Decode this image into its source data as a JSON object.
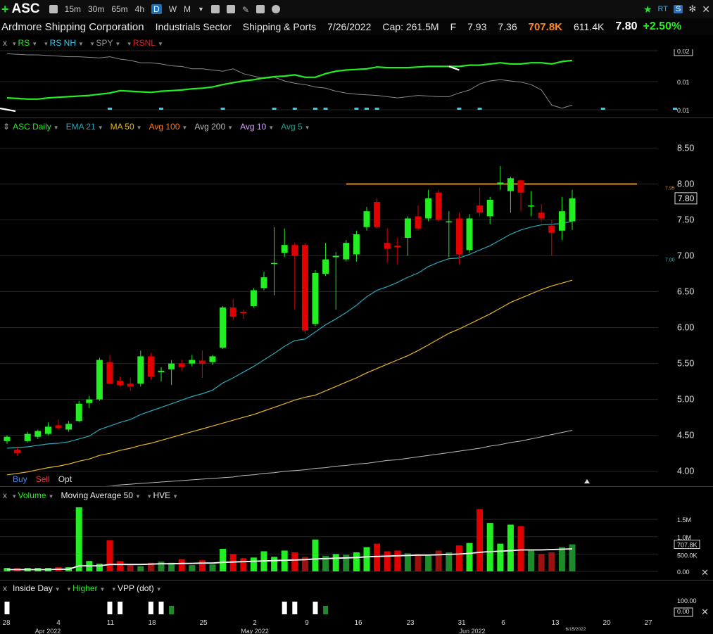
{
  "toolbar": {
    "symbol": "ASC",
    "timeframes": [
      "15m",
      "30m",
      "65m",
      "4h",
      "D",
      "W",
      "M"
    ],
    "active_timeframe": "D",
    "right_rt": "RT",
    "right_s": "S"
  },
  "info": {
    "company": "Ardmore Shipping Corporation",
    "sector": "Industrials Sector",
    "industry": "Shipping & Ports",
    "date": "7/26/2022",
    "cap": "Cap: 261.5M",
    "f": "F",
    "high": "7.93",
    "low": "7.36",
    "volume": "707.8K",
    "avg_volume": "611.4K",
    "last": "7.80",
    "change": "+2.50%"
  },
  "colors": {
    "up": "#22ee22",
    "down": "#e00000",
    "ema21": "#2aa7b8",
    "ma50": "#e8b820",
    "avg200": "#bbbbbb",
    "resistance": "#e08a18",
    "background": "#000000"
  },
  "rs_panel": {
    "legend": [
      {
        "label": "RS",
        "color": "#22ee22"
      },
      {
        "label": "RS NH",
        "color": "#33ccee"
      },
      {
        "label": "SPY",
        "color": "#999999"
      },
      {
        "label": "RSNL",
        "color": "#dd2222"
      }
    ],
    "axis_labels": [
      "0.02",
      "0.01",
      "0.01"
    ]
  },
  "price_legend": [
    {
      "label": "ASC Daily",
      "color": "#22ee22"
    },
    {
      "label": "EMA 21",
      "color": "#2aa7b8"
    },
    {
      "label": "MA 50",
      "color": "#e8b820"
    },
    {
      "label": "Avg 100",
      "color": "#ff7a1a"
    },
    {
      "label": "Avg 200",
      "color": "#bbbbbb"
    },
    {
      "label": "Avg 10",
      "color": "#d9a6ff"
    },
    {
      "label": "Avg 5",
      "color": "#2e9e8e"
    }
  ],
  "order_buttons": {
    "buy": "Buy",
    "sell": "Sell",
    "opt": "Opt"
  },
  "volume_legend": [
    {
      "label": "Volume",
      "color": "#22ee22"
    },
    {
      "label": "Moving Average 50",
      "color": "#eeeeee"
    },
    {
      "label": "HVE",
      "color": "#eeeeee"
    }
  ],
  "volume_axis": [
    "1.5M",
    "1.0M",
    "707.8K",
    "500.0K",
    "0.00"
  ],
  "indicator_legend": [
    {
      "label": "Inside Day",
      "color": "#eeeeee"
    },
    {
      "label": "Higher",
      "color": "#22ee22"
    },
    {
      "label": "VPP (dot)",
      "color": "#eeeeee"
    }
  ],
  "indicator_axis": [
    "100.00",
    "0.00"
  ],
  "x_axis": {
    "day_labels": [
      "28",
      "4",
      "11",
      "18",
      "25",
      "2",
      "9",
      "16",
      "23",
      "31",
      "6",
      "13",
      "20",
      "27"
    ],
    "month_labels": [
      "Apr 2022",
      "May 2022",
      "Jun 2022"
    ],
    "cursor_date": "6/15/2022"
  },
  "price_axis": {
    "ticks": [
      "8.50",
      "8.00",
      "7.50",
      "7.00",
      "6.50",
      "6.00",
      "5.50",
      "5.00",
      "4.50",
      "4.00"
    ],
    "last_label": "7.80",
    "small_top": "7.95",
    "small_low": "7.00"
  },
  "chart_data": {
    "type": "candlestick",
    "ylim": [
      3.85,
      8.7
    ],
    "resistance": 8.0,
    "candles": [
      [
        4.42,
        4.5,
        4.38,
        4.48
      ],
      [
        4.3,
        4.33,
        4.22,
        4.25
      ],
      [
        4.42,
        4.55,
        4.4,
        4.52
      ],
      [
        4.48,
        4.58,
        4.45,
        4.56
      ],
      [
        4.52,
        4.68,
        4.5,
        4.62
      ],
      [
        4.64,
        4.72,
        4.58,
        4.6
      ],
      [
        4.58,
        4.7,
        4.55,
        4.66
      ],
      [
        4.7,
        4.98,
        4.68,
        4.94
      ],
      [
        4.95,
        5.05,
        4.88,
        5.0
      ],
      [
        5.0,
        5.58,
        4.98,
        5.55
      ],
      [
        5.52,
        5.62,
        5.22,
        5.22
      ],
      [
        5.26,
        5.32,
        5.18,
        5.2
      ],
      [
        5.22,
        5.3,
        5.12,
        5.18
      ],
      [
        5.22,
        5.68,
        5.18,
        5.6
      ],
      [
        5.6,
        5.65,
        5.28,
        5.32
      ],
      [
        5.38,
        5.45,
        5.25,
        5.4
      ],
      [
        5.42,
        5.55,
        5.2,
        5.5
      ],
      [
        5.5,
        5.55,
        5.4,
        5.45
      ],
      [
        5.5,
        5.62,
        5.46,
        5.55
      ],
      [
        5.54,
        5.68,
        5.3,
        5.5
      ],
      [
        5.52,
        5.62,
        5.48,
        5.6
      ],
      [
        5.72,
        6.3,
        5.7,
        6.28
      ],
      [
        6.28,
        6.4,
        6.1,
        6.15
      ],
      [
        6.22,
        6.25,
        6.12,
        6.2
      ],
      [
        6.3,
        6.55,
        6.28,
        6.52
      ],
      [
        6.55,
        6.78,
        6.52,
        6.7
      ],
      [
        6.9,
        7.4,
        6.45,
        6.9
      ],
      [
        7.04,
        7.38,
        6.98,
        7.15
      ],
      [
        7.15,
        7.18,
        6.25,
        7.0
      ],
      [
        7.15,
        7.18,
        5.92,
        5.96
      ],
      [
        6.05,
        6.8,
        6.02,
        6.76
      ],
      [
        6.75,
        7.18,
        6.72,
        6.95
      ],
      [
        6.98,
        7.05,
        6.25,
        7.0
      ],
      [
        6.95,
        7.22,
        6.92,
        7.18
      ],
      [
        7.02,
        7.35,
        6.92,
        7.3
      ],
      [
        7.4,
        7.68,
        7.35,
        7.62
      ],
      [
        7.75,
        7.8,
        7.38,
        7.4
      ],
      [
        7.18,
        7.38,
        6.9,
        7.1
      ],
      [
        7.14,
        7.25,
        6.88,
        7.12
      ],
      [
        7.25,
        7.55,
        7.0,
        7.52
      ],
      [
        7.55,
        7.7,
        7.35,
        7.38
      ],
      [
        7.52,
        7.92,
        7.48,
        7.8
      ],
      [
        7.88,
        7.92,
        7.48,
        7.5
      ],
      [
        7.48,
        7.62,
        6.98,
        7.48
      ],
      [
        7.52,
        7.6,
        6.88,
        7.02
      ],
      [
        7.08,
        7.58,
        7.04,
        7.52
      ],
      [
        7.7,
        7.95,
        7.55,
        7.6
      ],
      [
        7.55,
        7.82,
        7.44,
        7.78
      ],
      [
        8.0,
        8.25,
        7.92,
        8.02
      ],
      [
        7.9,
        8.1,
        7.6,
        8.08
      ],
      [
        8.05,
        8.06,
        7.62,
        7.88
      ],
      [
        7.7,
        7.9,
        7.55,
        7.7
      ],
      [
        7.6,
        7.72,
        7.48,
        7.52
      ],
      [
        7.42,
        7.5,
        7.0,
        7.32
      ],
      [
        7.35,
        7.82,
        7.22,
        7.62
      ],
      [
        7.48,
        7.92,
        7.36,
        7.8
      ]
    ],
    "ema21": [
      4.32,
      4.33,
      4.34,
      4.36,
      4.38,
      4.39,
      4.41,
      4.45,
      4.49,
      4.58,
      4.63,
      4.68,
      4.72,
      4.79,
      4.84,
      4.89,
      4.94,
      4.99,
      5.04,
      5.08,
      5.13,
      5.23,
      5.3,
      5.38,
      5.46,
      5.55,
      5.64,
      5.74,
      5.82,
      5.84,
      5.94,
      6.04,
      6.12,
      6.21,
      6.31,
      6.43,
      6.52,
      6.57,
      6.63,
      6.7,
      6.76,
      6.85,
      6.91,
      6.96,
      6.97,
      7.02,
      7.08,
      7.14,
      7.22,
      7.3,
      7.36,
      7.4,
      7.43,
      7.44,
      7.45,
      7.48
    ],
    "ma50": [
      3.95,
      3.97,
      3.99,
      4.02,
      4.05,
      4.07,
      4.1,
      4.14,
      4.17,
      4.22,
      4.25,
      4.29,
      4.32,
      4.36,
      4.39,
      4.43,
      4.47,
      4.51,
      4.55,
      4.59,
      4.63,
      4.67,
      4.71,
      4.75,
      4.79,
      4.84,
      4.89,
      4.94,
      4.99,
      5.03,
      5.06,
      5.12,
      5.18,
      5.24,
      5.3,
      5.37,
      5.43,
      5.49,
      5.55,
      5.61,
      5.68,
      5.76,
      5.84,
      5.92,
      5.98,
      6.05,
      6.12,
      6.19,
      6.27,
      6.35,
      6.41,
      6.47,
      6.53,
      6.58,
      6.62,
      6.66
    ],
    "avg200": [
      3.7,
      3.71,
      3.72,
      3.73,
      3.74,
      3.75,
      3.76,
      3.77,
      3.78,
      3.79,
      3.8,
      3.81,
      3.82,
      3.83,
      3.84,
      3.85,
      3.86,
      3.87,
      3.88,
      3.89,
      3.9,
      3.91,
      3.92,
      3.94,
      3.95,
      3.97,
      3.98,
      4.0,
      4.01,
      4.02,
      4.04,
      4.05,
      4.07,
      4.08,
      4.1,
      4.11,
      4.13,
      4.15,
      4.16,
      4.18,
      4.2,
      4.22,
      4.24,
      4.26,
      4.28,
      4.3,
      4.32,
      4.35,
      4.37,
      4.4,
      4.42,
      4.45,
      4.48,
      4.51,
      4.54,
      4.57
    ],
    "volume": [
      0.1,
      0.1,
      0.1,
      0.1,
      0.1,
      0.12,
      0.12,
      1.85,
      0.3,
      0.22,
      0.9,
      0.3,
      0.18,
      0.15,
      0.25,
      0.28,
      0.25,
      0.35,
      0.18,
      0.32,
      0.2,
      0.65,
      0.5,
      0.38,
      0.4,
      0.58,
      0.42,
      0.6,
      0.55,
      0.42,
      0.92,
      0.45,
      0.5,
      0.48,
      0.55,
      0.7,
      0.8,
      0.58,
      0.6,
      0.52,
      0.5,
      0.45,
      0.6,
      0.55,
      0.75,
      0.82,
      1.8,
      1.4,
      0.8,
      1.35,
      1.3,
      0.6,
      0.5,
      0.55,
      0.7,
      0.78
    ],
    "vol_ma50": [
      0.05,
      0.05,
      0.05,
      0.05,
      0.05,
      0.06,
      0.06,
      0.16,
      0.16,
      0.16,
      0.2,
      0.2,
      0.2,
      0.2,
      0.21,
      0.22,
      0.22,
      0.23,
      0.23,
      0.24,
      0.24,
      0.26,
      0.27,
      0.28,
      0.29,
      0.3,
      0.31,
      0.32,
      0.33,
      0.34,
      0.36,
      0.37,
      0.38,
      0.39,
      0.4,
      0.42,
      0.43,
      0.44,
      0.45,
      0.46,
      0.47,
      0.47,
      0.48,
      0.49,
      0.5,
      0.52,
      0.55,
      0.57,
      0.58,
      0.6,
      0.62,
      0.62,
      0.62,
      0.63,
      0.64,
      0.65
    ],
    "rs": [
      0.22,
      0.21,
      0.2,
      0.2,
      0.22,
      0.23,
      0.24,
      0.25,
      0.26,
      0.28,
      0.3,
      0.34,
      0.33,
      0.32,
      0.31,
      0.33,
      0.34,
      0.35,
      0.37,
      0.38,
      0.4,
      0.44,
      0.47,
      0.5,
      0.52,
      0.55,
      0.57,
      0.58,
      0.6,
      0.56,
      0.56,
      0.62,
      0.66,
      0.68,
      0.69,
      0.7,
      0.73,
      0.72,
      0.72,
      0.72,
      0.73,
      0.74,
      0.74,
      0.74,
      0.74,
      0.76,
      0.76,
      0.78,
      0.8,
      0.78,
      0.78,
      0.8,
      0.8,
      0.78,
      0.82,
      0.84
    ],
    "spy": [
      0.95,
      0.94,
      0.93,
      0.93,
      0.92,
      0.91,
      0.9,
      0.9,
      0.89,
      0.88,
      0.9,
      0.86,
      0.84,
      0.8,
      0.8,
      0.78,
      0.75,
      0.74,
      0.7,
      0.7,
      0.68,
      0.66,
      0.7,
      0.62,
      0.58,
      0.54,
      0.56,
      0.5,
      0.46,
      0.44,
      0.4,
      0.38,
      0.33,
      0.3,
      0.28,
      0.27,
      0.26,
      0.24,
      0.22,
      0.24,
      0.26,
      0.25,
      0.24,
      0.24,
      0.3,
      0.35,
      0.45,
      0.5,
      0.52,
      0.5,
      0.48,
      0.44,
      0.35,
      0.1,
      0.05,
      0.1
    ],
    "rs_nh": [
      10,
      15,
      21,
      26,
      28,
      30,
      31,
      34,
      35,
      36,
      44,
      46,
      58,
      65
    ],
    "inside_day": [
      0,
      10,
      11,
      14,
      15,
      27,
      28,
      30
    ],
    "higher": [
      16,
      31
    ]
  }
}
